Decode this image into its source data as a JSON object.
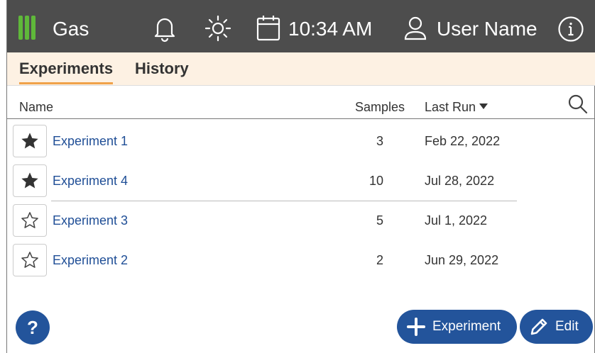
{
  "header": {
    "app_name": "Gas",
    "time": "10:34 AM",
    "user_name": "User Name",
    "icons": [
      "logo-bars-icon",
      "bell-icon",
      "brightness-icon",
      "calendar-icon",
      "user-icon",
      "info-icon"
    ]
  },
  "tabs": [
    {
      "label": "Experiments",
      "active": true
    },
    {
      "label": "History",
      "active": false
    }
  ],
  "table": {
    "columns": {
      "name": "Name",
      "samples": "Samples",
      "last_run": "Last Run"
    },
    "sort": "last_run-desc",
    "rows": [
      {
        "favorite": true,
        "name": "Experiment 1",
        "samples": "3",
        "last_run": "Feb 22, 2022"
      },
      {
        "favorite": true,
        "name": "Experiment 4",
        "samples": "10",
        "last_run": "Jul 28, 2022"
      },
      {
        "favorite": false,
        "name": "Experiment 3",
        "samples": "5",
        "last_run": "Jul 1, 2022"
      },
      {
        "favorite": false,
        "name": "Experiment 2",
        "samples": "2",
        "last_run": "Jun 29, 2022"
      }
    ]
  },
  "footer": {
    "help_label": "?",
    "add_label": "Experiment",
    "edit_label": "Edit"
  },
  "colors": {
    "header_bg": "#4d4d4d",
    "logo_green": "#5fb83a",
    "tab_bg": "#fdf1e3",
    "tab_underline": "#f0a24a",
    "link": "#1f4e96",
    "button": "#23549b"
  }
}
